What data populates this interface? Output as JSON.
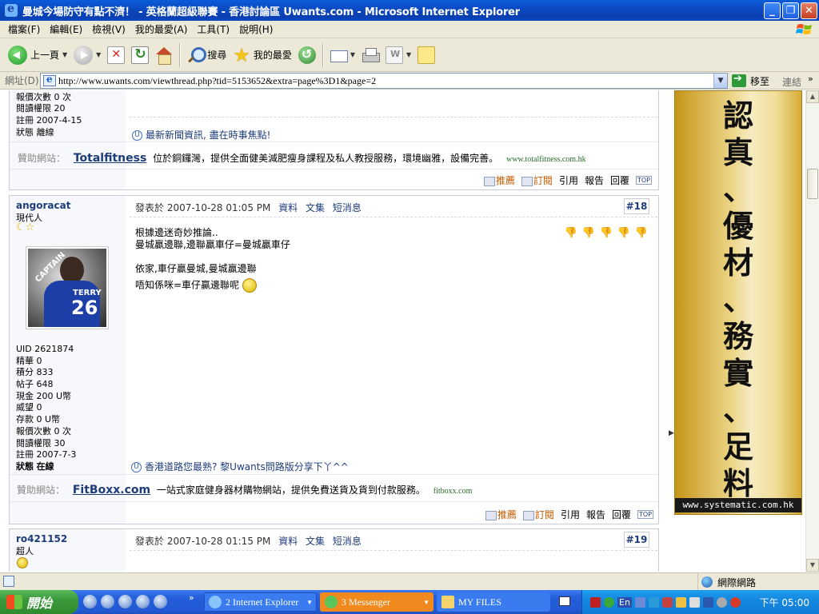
{
  "window": {
    "title": "曼城今場防守有點不濟！ - 英格蘭超級聯賽 - 香港討論區 Uwants.com - Microsoft Internet Explorer",
    "minimize": "_",
    "maximize": "❐",
    "close": "✕"
  },
  "menu": [
    "檔案(F)",
    "編輯(E)",
    "檢視(V)",
    "我的最愛(A)",
    "工具(T)",
    "說明(H)"
  ],
  "toolbar": {
    "back_label": "上一頁",
    "search_label": "搜尋",
    "favorites_label": "我的最愛"
  },
  "address": {
    "label": "網址(D)",
    "url": "http://www.uwants.com/viewthread.php?tid=5153652&extra=page%3D1&page=2",
    "go_label": "移至",
    "links_label": "連結"
  },
  "prev_post": {
    "stats": [
      "報價次數 0 次",
      "閱讀權限 20",
      "註冊 2007-4-15",
      "狀態 離線"
    ],
    "signature": "最新新聞資訊, 盡在時事焦點!",
    "sponsor": {
      "label": "贊助網站：",
      "name": "Totalfitness",
      "desc": "位於銅鑼灣，提供全面健美減肥瘦身課程及私人教授服務，環境幽雅，設備完善。",
      "url": "www.totalfitness.com.hk"
    }
  },
  "post18": {
    "author": "angoracat",
    "rank": "現代人",
    "stars": "☾☆",
    "avatar": {
      "captain": "CAPTAIN",
      "name": "TERRY",
      "number": "26"
    },
    "meta": {
      "posted": "發表於 2007-10-28 01:05 PM",
      "profile": "資料",
      "collection": "文集",
      "message": "短消息"
    },
    "floor": "#18",
    "content": [
      "根據邊迷奇妙推論..",
      "曼城贏邊聯,邊聯贏車仔=曼城贏車仔",
      "",
      "依家,車仔贏曼城,曼城贏邊聯",
      "唔知係咪=車仔贏邊聯呢"
    ],
    "stats": [
      {
        "text": "UID 2621874"
      },
      {
        "text": "精華 0"
      },
      {
        "text": "積分 833"
      },
      {
        "text": "帖子 648"
      },
      {
        "text": "現金 200 U幣"
      },
      {
        "text": "威望 0"
      },
      {
        "text": "存款 0 U幣"
      },
      {
        "text": "報價次數 0 次"
      },
      {
        "text": "閱讀權限 30"
      },
      {
        "text": "註冊 2007-7-3"
      }
    ],
    "status_label": "狀態",
    "status_value": "在線",
    "signature": "香港道路您最熟? 黎Uwants問路版分享下丫^^",
    "sponsor": {
      "label": "贊助網站：",
      "name": "FitBoxx.com",
      "desc": "一站式家庭健身器材購物網站，提供免費送貨及貨到付款服務。",
      "url": "fitboxx.com"
    }
  },
  "actions": {
    "recommend": "推薦",
    "subscribe": "訂閱",
    "quote": "引用",
    "report": "報告",
    "reply": "回覆",
    "top": "TOP"
  },
  "post19": {
    "author": "ro421152",
    "rank": "超人",
    "meta": {
      "posted": "發表於 2007-10-28 01:15 PM",
      "profile": "資料",
      "collection": "文集",
      "message": "短消息"
    },
    "floor": "#19"
  },
  "banner": {
    "chars": [
      "認",
      "真",
      "、",
      "優",
      "材",
      "、",
      "務",
      "實",
      "、",
      "足",
      "料"
    ],
    "url": "www.systematic.com.hk"
  },
  "statusbar": {
    "zone": "網際網路"
  },
  "taskbar": {
    "start": "開始",
    "tasks": [
      {
        "label": "2 Internet Explorer",
        "color": "#3a7cf0"
      },
      {
        "label": "3 Messenger",
        "color": "#f08a1e"
      },
      {
        "label": "MY FILES",
        "color": "#3a7cf0"
      }
    ],
    "lang": "En",
    "clock": "下午 05:00"
  }
}
